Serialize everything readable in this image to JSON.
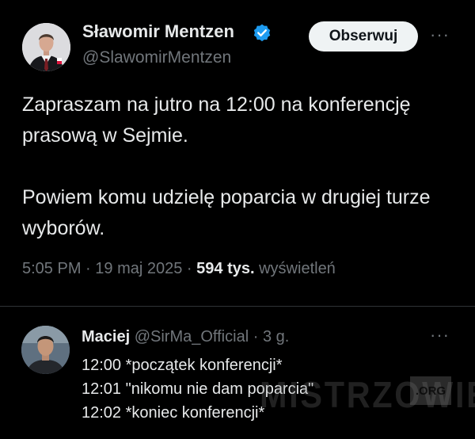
{
  "tweet": {
    "author_name": "Sławomir Mentzen",
    "handle": "@SlawomirMentzen",
    "follow_label": "Obserwuj",
    "more_label": "···",
    "paragraphs": [
      "Zapraszam na jutro na 12:00 na konferencję prasową w Sejmie.",
      "Powiem komu udzielę poparcia w drugiej turze wyborów."
    ],
    "time": "5:05 PM",
    "separator": "·",
    "date": "19 maj 2025",
    "views_count": "594 tys.",
    "views_label": "wyświetleń"
  },
  "reply": {
    "name": "Maciej",
    "handle": "@SirMa_Official",
    "separator": "·",
    "age": "3 g.",
    "more_label": "···",
    "lines": [
      "12:00 *początek konferencji*",
      "12:01 \"nikomu nie dam poparcia\"",
      "12:02 *koniec konferencji*"
    ]
  },
  "watermark": {
    "text": "MISTRZOWIE",
    "suffix": ".ORG"
  },
  "colors": {
    "background": "#000000",
    "text": "#e7e9ea",
    "secondary": "#71767b",
    "verified": "#1d9bf0",
    "follow_bg": "#eff3f4",
    "divider": "#2f3336"
  },
  "icons": {
    "verified": "verified-badge-icon",
    "more": "more-options-icon"
  }
}
